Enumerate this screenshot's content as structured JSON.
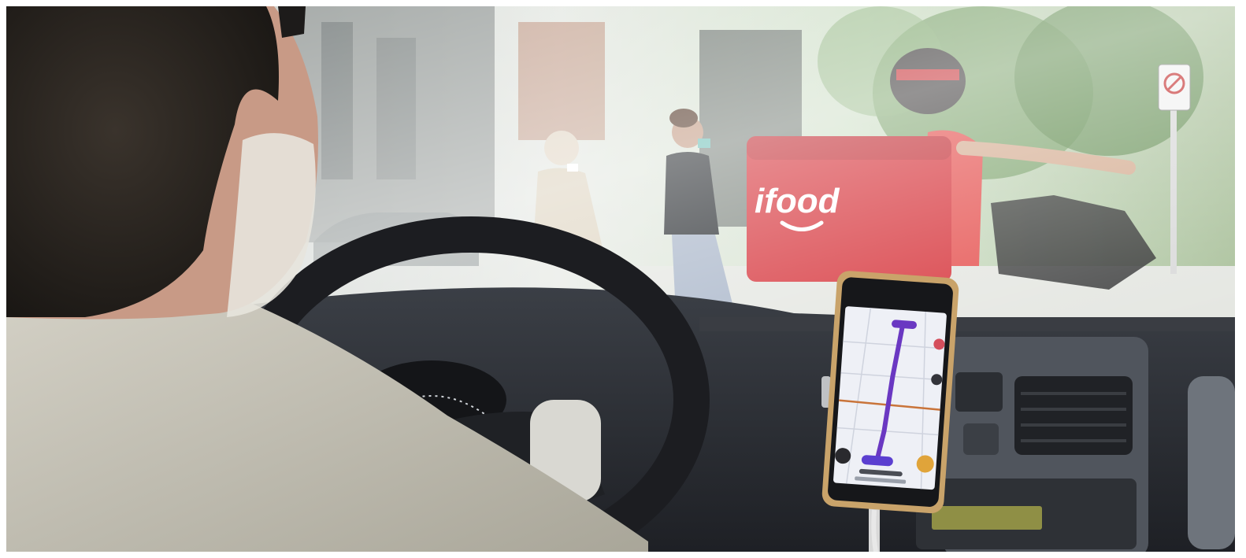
{
  "scene": {
    "brand_text": "ifood",
    "colors": {
      "street_bright": "#e8ece6",
      "ifood_red": "#d6333a",
      "dashboard": "#2a2d33",
      "shirt": "#c9c5b8",
      "hair": "#2b2622",
      "phone_screen": "#eef0f6",
      "route": "#6a38c2"
    }
  }
}
